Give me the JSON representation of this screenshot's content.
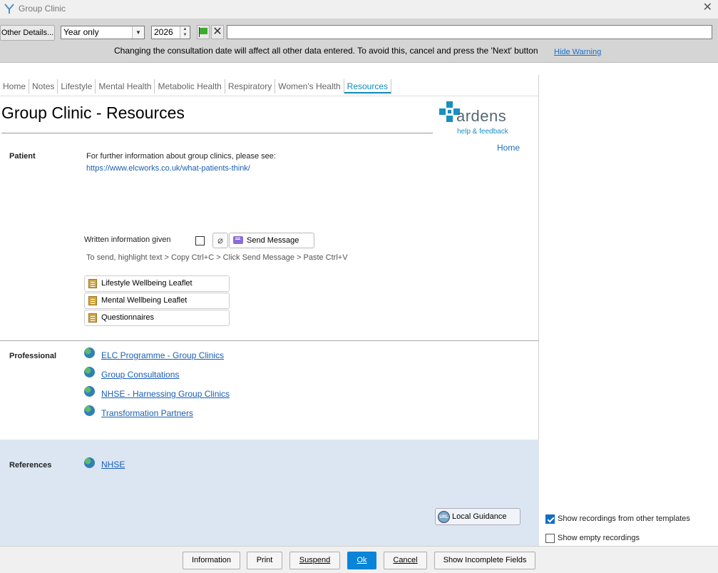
{
  "window": {
    "title": "Group Clinic",
    "logo_icon": "ardens-logo-icon",
    "close_icon": "close-icon"
  },
  "toolbar": {
    "other_details_label": "Other Details...",
    "date_precision_value": "Year only",
    "year_value": "2026",
    "date_warning": "Changing the consultation date will affect all other data entered. To avoid this, cancel and press the 'Next' button",
    "hide_warning_label": "Hide Warning",
    "flag_color": "#3dab2e"
  },
  "tabs": [
    "Home",
    "Notes",
    "Lifestyle",
    "Mental Health",
    "Metabolic Health",
    "Respiratory",
    "Women's Health",
    "Resources"
  ],
  "active_tab": "Resources",
  "page": {
    "title": "Group Clinic - Resources",
    "brand_name": "ardens",
    "brand_tagline": "help & feedback",
    "home_link": "Home"
  },
  "patient": {
    "section_label": "Patient",
    "info_text": "For further information about group clinics, please see:",
    "info_url": "https://www.elcworks.co.uk/what-patients-think/",
    "written_info_label": "Written information given",
    "send_message_label": "Send Message",
    "send_hint": "To send, highlight text > Copy Ctrl+C > Click Send Message > Paste Ctrl+V",
    "leaflets": [
      "Lifestyle Wellbeing Leaflet",
      "Mental Wellbeing Leaflet",
      "Questionnaires"
    ]
  },
  "professional": {
    "section_label": "Professional",
    "links": [
      "ELC Programme - Group Clinics",
      "Group Consultations",
      "NHSE - Harnessing Group Clinics",
      "Transformation Partners"
    ]
  },
  "references": {
    "section_label": "References",
    "links": [
      "NHSE"
    ],
    "local_guidance_label": "Local Guidance",
    "url_badge": "URL",
    "background_color": "#dce6f2"
  },
  "options": {
    "show_other_templates_label": "Show recordings from other templates",
    "show_other_templates_checked": true,
    "show_empty_label": "Show empty recordings",
    "show_empty_checked": false
  },
  "footer": {
    "information_label": "Information",
    "print_label": "Print",
    "suspend_label": "Suspend",
    "ok_label": "Ok",
    "cancel_label": "Cancel",
    "incomplete_label": "Show Incomplete Fields",
    "ok_color": "#0a84d8"
  }
}
